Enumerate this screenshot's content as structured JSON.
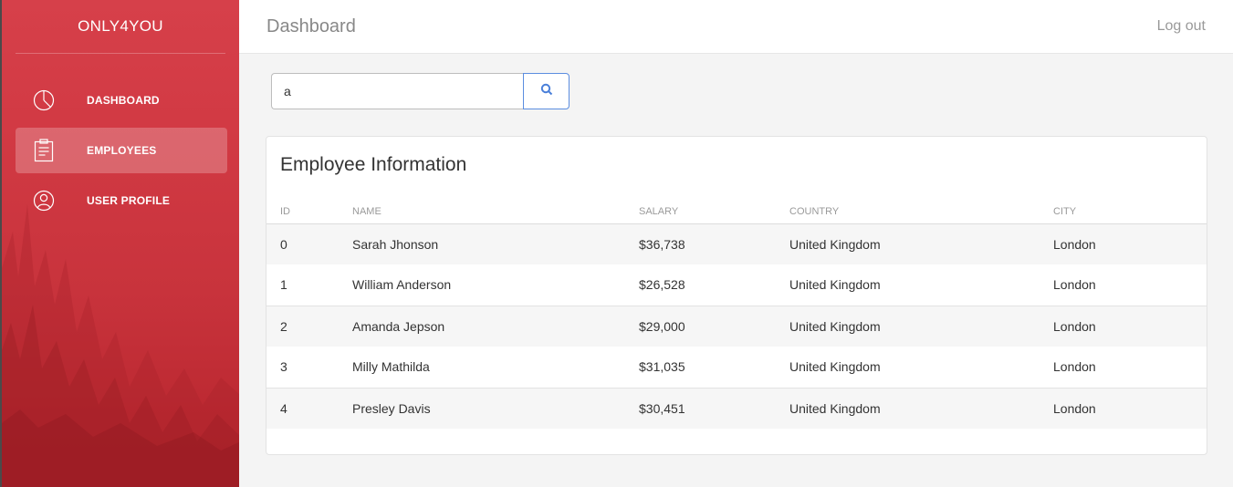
{
  "sidebar": {
    "brand": "ONLY4YOU",
    "items": [
      {
        "label": "DASHBOARD",
        "icon": "pie-chart-icon",
        "active": false
      },
      {
        "label": "EMPLOYEES",
        "icon": "clipboard-icon",
        "active": true
      },
      {
        "label": "USER PROFILE",
        "icon": "user-icon",
        "active": false
      }
    ]
  },
  "header": {
    "title": "Dashboard",
    "logout_label": "Log out"
  },
  "search": {
    "value": "a",
    "icon": "search-icon"
  },
  "table": {
    "title": "Employee Information",
    "columns": [
      "ID",
      "NAME",
      "SALARY",
      "COUNTRY",
      "CITY"
    ],
    "rows": [
      {
        "id": "0",
        "name": "Sarah Jhonson",
        "salary": "$36,738",
        "country": "United Kingdom",
        "city": "London"
      },
      {
        "id": "1",
        "name": "William Anderson",
        "salary": "$26,528",
        "country": "United Kingdom",
        "city": "London"
      },
      {
        "id": "2",
        "name": "Amanda Jepson",
        "salary": "$29,000",
        "country": "United Kingdom",
        "city": "London"
      },
      {
        "id": "3",
        "name": "Milly Mathilda",
        "salary": "$31,035",
        "country": "United Kingdom",
        "city": "London"
      },
      {
        "id": "4",
        "name": "Presley Davis",
        "salary": "$30,451",
        "country": "United Kingdom",
        "city": "London"
      }
    ]
  },
  "colors": {
    "sidebar_accent": "#d23a44",
    "search_button_border": "#5b8de0",
    "search_icon": "#4a7fd9"
  }
}
